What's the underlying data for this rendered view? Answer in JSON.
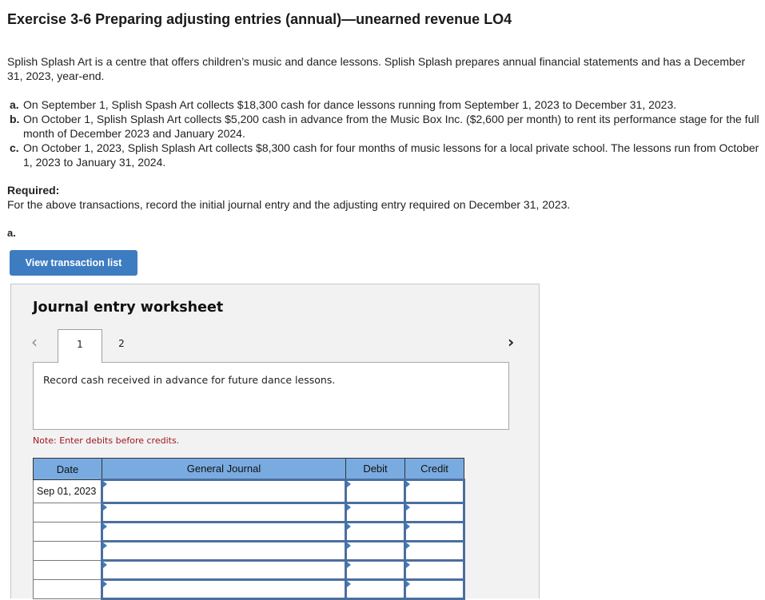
{
  "header": {
    "title": "Exercise 3-6 Preparing adjusting entries (annual)—unearned revenue LO4"
  },
  "intro": "Splish Splash Art is a centre that offers children’s music and dance lessons. Splish Splash prepares annual financial statements and has a December 31, 2023, year-end.",
  "transactions": [
    {
      "label": "a.",
      "text": "On September 1, Splish Spash Art collects $18,300 cash for dance lessons running from September 1, 2023 to December 31, 2023."
    },
    {
      "label": "b.",
      "text": "On October 1, Splish Splash Art collects $5,200 cash in advance from the Music Box Inc. ($2,600 per month) to rent its performance stage for the full month of December 2023 and January 2024."
    },
    {
      "label": "c.",
      "text": "On October 1, 2023, Splish Splash Art collects $8,300 cash for four months of music lessons for a local private school. The lessons run from October 1, 2023 to January 31, 2024."
    }
  ],
  "required": {
    "heading": "Required:",
    "text": "For the above transactions, record the initial journal entry and the adjusting entry required on December 31, 2023."
  },
  "part_label": "a.",
  "view_button_label": "View transaction list",
  "worksheet": {
    "title": "Journal entry worksheet",
    "prev_icon": "‹",
    "next_icon": "›",
    "tabs": [
      {
        "label": "1",
        "active": true
      },
      {
        "label": "2",
        "active": false
      }
    ],
    "description": "Record cash received in advance for future dance lessons.",
    "note": "Note: Enter debits before credits.",
    "table": {
      "headers": [
        "Date",
        "General Journal",
        "Debit",
        "Credit"
      ],
      "rows": [
        {
          "date": "Sep 01, 2023",
          "account": "",
          "debit": "",
          "credit": ""
        },
        {
          "date": "",
          "account": "",
          "debit": "",
          "credit": ""
        },
        {
          "date": "",
          "account": "",
          "debit": "",
          "credit": ""
        },
        {
          "date": "",
          "account": "",
          "debit": "",
          "credit": ""
        },
        {
          "date": "",
          "account": "",
          "debit": "",
          "credit": ""
        },
        {
          "date": "",
          "account": "",
          "debit": "",
          "credit": ""
        }
      ]
    }
  }
}
